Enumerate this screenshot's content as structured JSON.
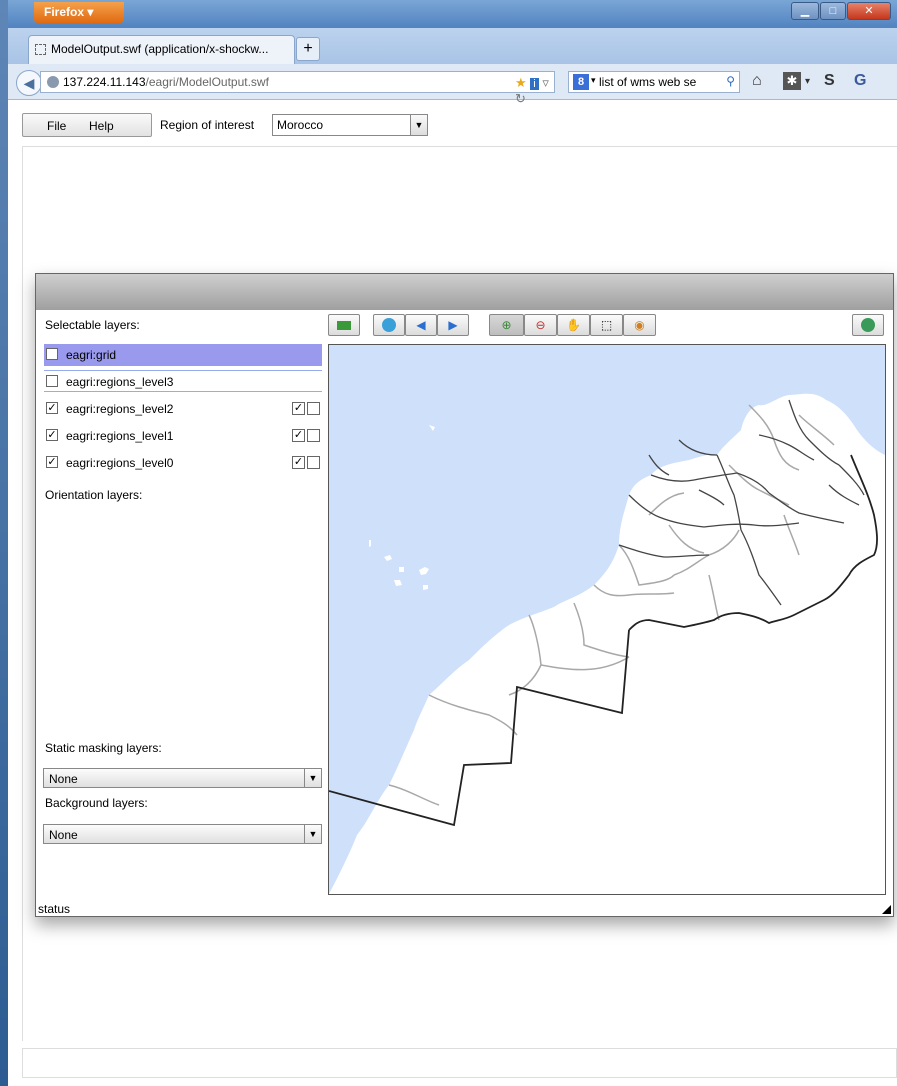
{
  "browser": {
    "app_button": "Firefox",
    "tab_title": "ModelOutput.swf (application/x-shockw...",
    "new_tab": "+",
    "url_host": "137.224.11.143",
    "url_path": "/eagri/ModelOutput.swf",
    "search_text": "list of wms web se",
    "search_engine_icon": "google-icon"
  },
  "menu": {
    "file": "File",
    "help": "Help",
    "region_label": "Region of interest",
    "region_value": "Morocco"
  },
  "panel": {
    "selectable_label": "Selectable layers:",
    "layers": [
      {
        "name": "eagri:grid",
        "checked": false
      },
      {
        "name": "eagri:regions_level3",
        "checked": false
      },
      {
        "name": "eagri:regions_level2",
        "checked": true
      },
      {
        "name": "eagri:regions_level1",
        "checked": true
      },
      {
        "name": "eagri:regions_level0",
        "checked": true
      }
    ],
    "orientation_label": "Orientation layers:",
    "static_mask_label": "Static masking layers:",
    "static_mask_value": "None",
    "background_label": "Background layers:",
    "background_value": "None",
    "status": "status"
  },
  "colors": {
    "sea": "#cfe0fb",
    "selected_row": "#9999ee",
    "border_level0": "#222222",
    "border_level2": "#a8a8a8"
  }
}
